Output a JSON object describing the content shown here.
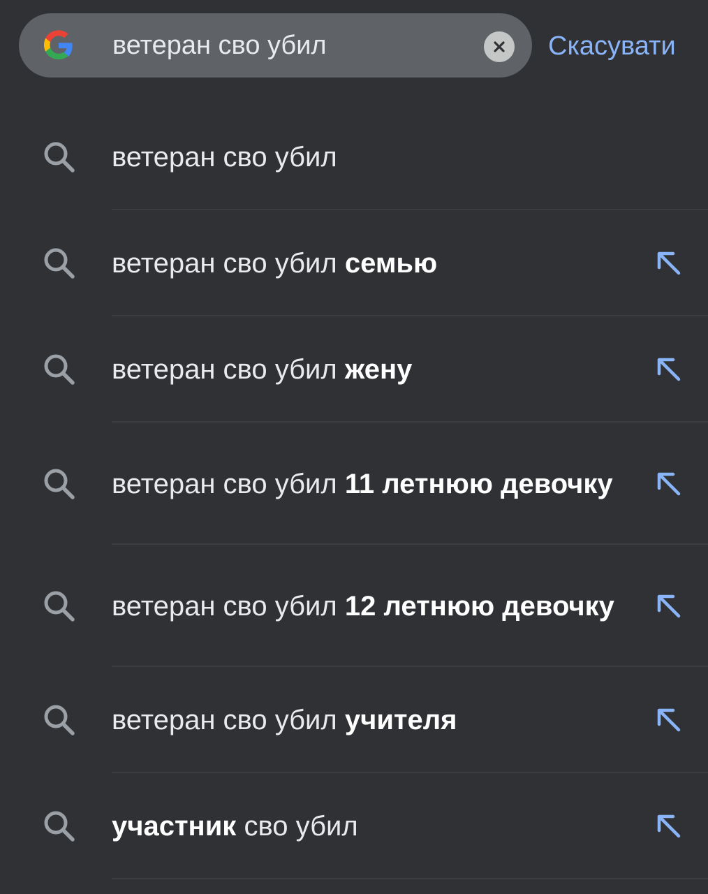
{
  "search": {
    "query": "ветеран сво убил",
    "cancel_label": "Скасувати"
  },
  "colors": {
    "background": "#303134",
    "search_bar": "#5f6368",
    "accent": "#8ab4f8"
  },
  "suggestions": [
    {
      "text_regular": "ветеран сво убил",
      "text_bold": "",
      "text_after": "",
      "fill_arrow": false
    },
    {
      "text_regular": "ветеран сво убил",
      "text_bold": "семью",
      "text_after": "",
      "fill_arrow": true
    },
    {
      "text_regular": "ветеран сво убил",
      "text_bold": "жену",
      "text_after": "",
      "fill_arrow": true
    },
    {
      "text_regular": "ветеран сво убил",
      "text_bold": "11 летнюю девочку",
      "text_after": "",
      "fill_arrow": true
    },
    {
      "text_regular": "ветеран сво убил",
      "text_bold": "12 летнюю девочку",
      "text_after": "",
      "fill_arrow": true
    },
    {
      "text_regular": "ветеран сво убил",
      "text_bold": "учителя",
      "text_after": "",
      "fill_arrow": true
    },
    {
      "text_regular": "",
      "text_bold": "участник",
      "text_after": "сво убил",
      "fill_arrow": true
    }
  ],
  "icons": {
    "logo": "google-g-icon",
    "clear": "clear-icon",
    "suggestion": "search-icon",
    "fill": "arrow-up-left-icon"
  }
}
